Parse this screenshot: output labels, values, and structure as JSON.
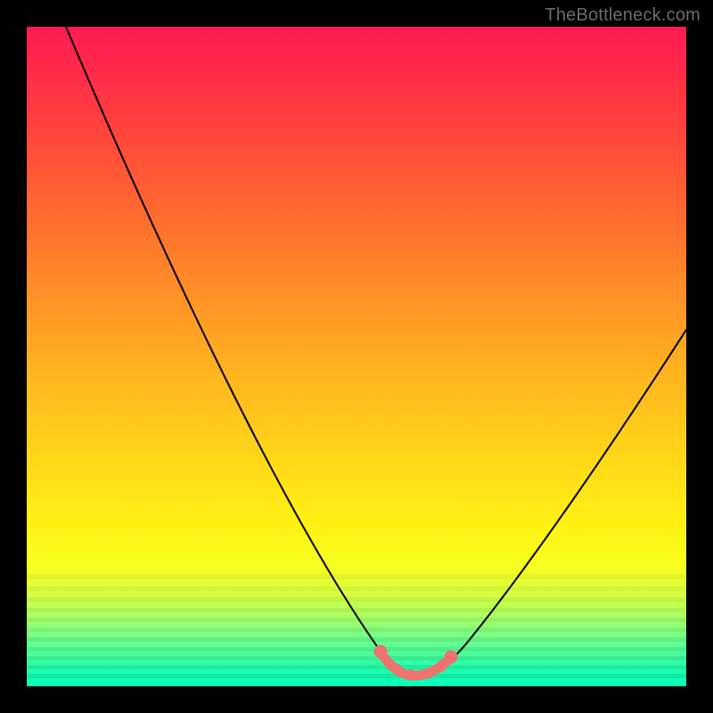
{
  "watermark": "TheBottleneck.com",
  "chart_data": {
    "type": "line",
    "title": "",
    "xlabel": "",
    "ylabel": "",
    "xlim": [
      0,
      100
    ],
    "ylim": [
      0,
      100
    ],
    "grid": false,
    "legend": false,
    "series": [
      {
        "name": "bottleneck-curve",
        "x": [
          6,
          10,
          14,
          18,
          22,
          26,
          30,
          34,
          38,
          42,
          46,
          50,
          52,
          54,
          56,
          58,
          60,
          62,
          64,
          68,
          72,
          76,
          80,
          84,
          88,
          92,
          96,
          100
        ],
        "values": [
          100,
          93,
          86,
          79,
          72,
          65,
          58,
          51,
          44,
          37,
          30,
          22,
          17,
          12,
          7,
          3,
          0,
          0,
          1,
          3,
          8,
          14,
          21,
          28,
          35,
          42,
          48,
          54
        ]
      }
    ],
    "highlight_range_x": [
      55,
      65
    ],
    "colors": {
      "curve": "#000000",
      "highlight": "#ee7370",
      "gradient_top": "#ff1a52",
      "gradient_bottom": "#06ffb9"
    }
  }
}
